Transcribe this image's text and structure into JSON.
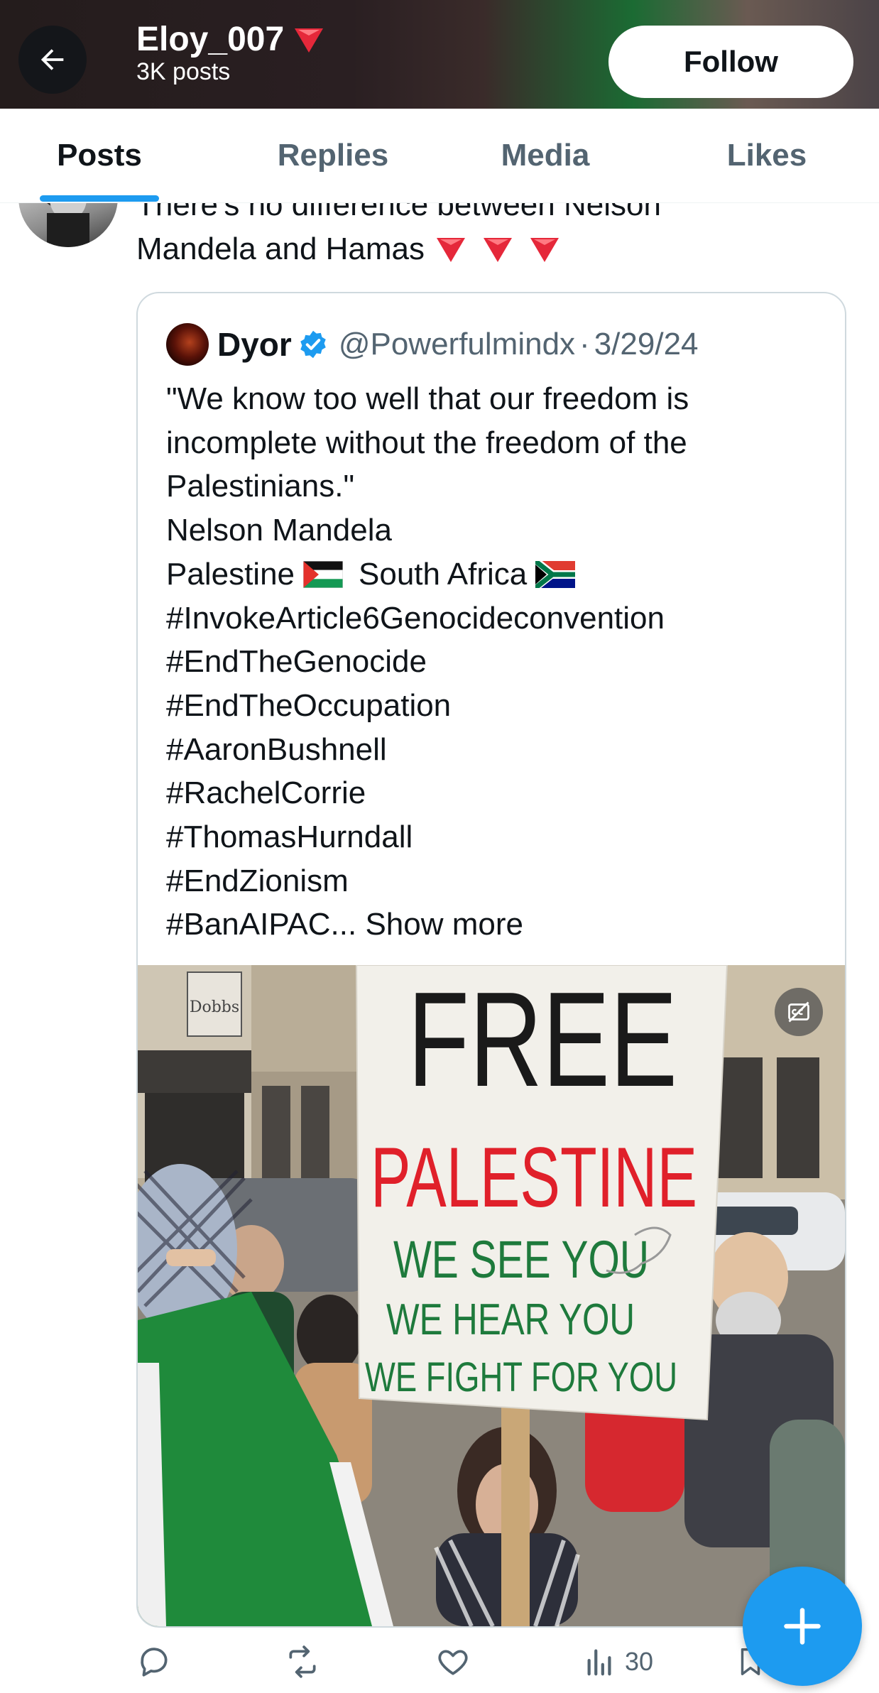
{
  "header": {
    "display_name": "Eloy_007",
    "name_badge_icon": "red-triangle-down-icon",
    "posts_count": "3K posts",
    "follow_label": "Follow"
  },
  "tabs": [
    {
      "label": "Posts",
      "active": true
    },
    {
      "label": "Replies",
      "active": false
    },
    {
      "label": "Media",
      "active": false
    },
    {
      "label": "Likes",
      "active": false
    }
  ],
  "post": {
    "text_line1": "There's no difference between Nelson",
    "text_line2": "Mandela and Hamas",
    "trailing_icons": [
      "red-triangle-down-icon",
      "red-triangle-down-icon",
      "red-triangle-down-icon"
    ]
  },
  "quote": {
    "name": "Dyor",
    "handle": "@Powerfulmindx",
    "separator": "·",
    "date": "3/29/24",
    "verified": true,
    "lines": [
      "\"We know too well that our freedom is",
      "incomplete without the freedom of the",
      "Palestinians.\"",
      "Nelson Mandela"
    ],
    "flag_line": {
      "left_text": "Palestine",
      "right_text": "South Africa",
      "left_flag": "palestine-flag-icon",
      "right_flag": "south-africa-flag-icon"
    },
    "hashtags": [
      "#InvokeArticle6Genocideconvention",
      "#EndTheGenocide",
      "#EndTheOccupation",
      "#AaronBushnell",
      "#RachelCorrie",
      "#ThomasHurndall",
      "#EndZionism"
    ],
    "last_line": "#BanAIPAC...",
    "show_more": "Show more",
    "media": {
      "sign_line1": "FREE",
      "sign_line2": "PALESTINE",
      "sign_line3": "WE SEE YOU",
      "sign_line4": "WE HEAR YOU",
      "sign_line5": "WE FIGHT FOR YOU",
      "storefront_sign": "Dobbs",
      "caption_button_icon": "captions-off-icon"
    }
  },
  "actions": {
    "views": "30"
  },
  "colors": {
    "accent": "#1d9bf0",
    "text_primary": "#0f1419",
    "text_secondary": "#536471",
    "border": "#cfd9de",
    "sign_red": "#e0202a",
    "sign_green": "#1e7a3c"
  }
}
